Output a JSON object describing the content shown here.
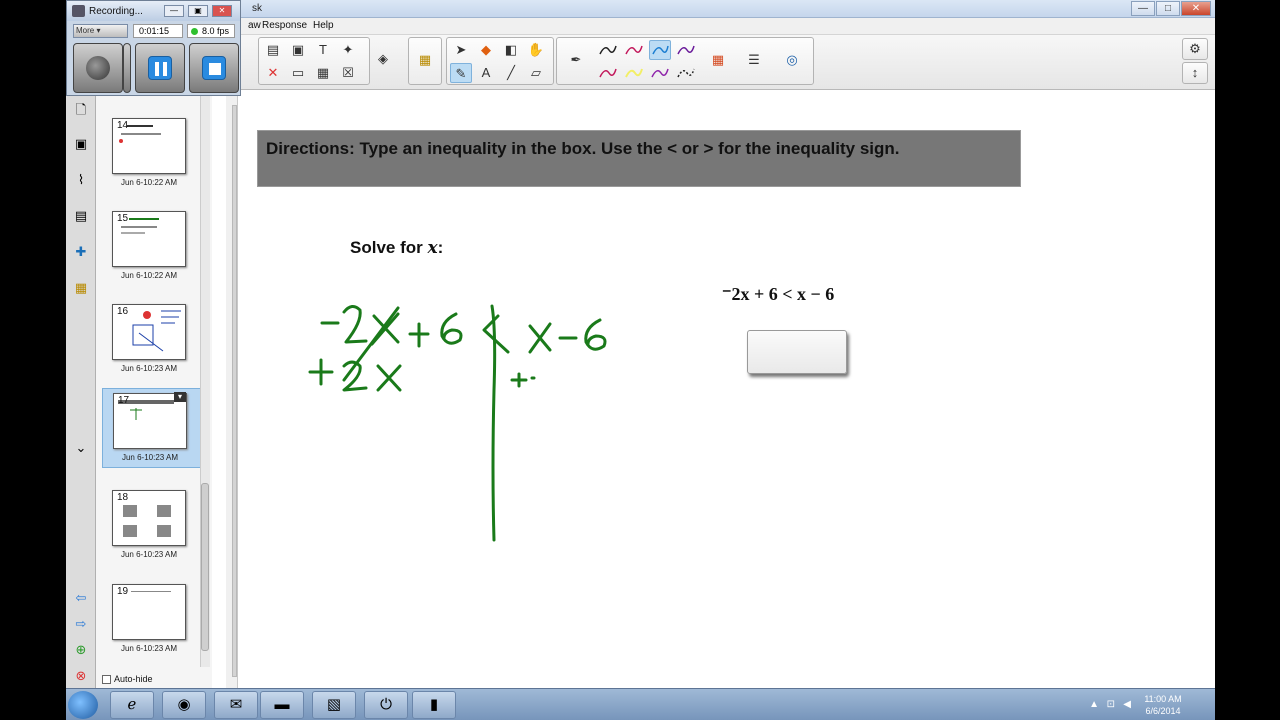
{
  "window": {
    "title_fragment": "sk",
    "min_icon": "—",
    "max_icon": "□",
    "close_icon": "✕"
  },
  "menu": {
    "items": [
      "aw",
      "Response",
      "Help"
    ]
  },
  "recorder": {
    "title": "Recording...",
    "mode": "More",
    "elapsed": "0:01:15",
    "fps": "8.0 fps",
    "min_icon": "—",
    "restore_icon": "▣",
    "close_icon": "✕"
  },
  "slides": [
    {
      "number": "14",
      "date": "Jun 6-10:22 AM"
    },
    {
      "number": "15",
      "date": "Jun 6-10:22 AM"
    },
    {
      "number": "16",
      "date": "Jun 6-10:23 AM"
    },
    {
      "number": "17",
      "date": "Jun 6-10:23 AM"
    },
    {
      "number": "18",
      "date": "Jun 6-10:23 AM"
    },
    {
      "number": "19",
      "date": "Jun 6-10:23 AM"
    }
  ],
  "sorter": {
    "autohide_label": "Auto-hide"
  },
  "page": {
    "directions": "Directions: Type an inequality in the box. Use the < or > for the inequality sign.",
    "solve_prefix": "Solve for ",
    "solve_var": "x",
    "solve_suffix": ":",
    "equation": "⁻2x + 6 < x − 6",
    "answer_value": ""
  },
  "ink": {
    "color": "#1a7a1a"
  },
  "taskbar": {
    "time": "11:00 AM",
    "date": "6/6/2014"
  },
  "colors": {
    "pen_colors": [
      "#222222",
      "#c2185b",
      "#1b7ed1",
      "#6a1b9a",
      "#c2185b",
      "#f2ef66",
      "#8e24aa",
      "#222222"
    ]
  }
}
